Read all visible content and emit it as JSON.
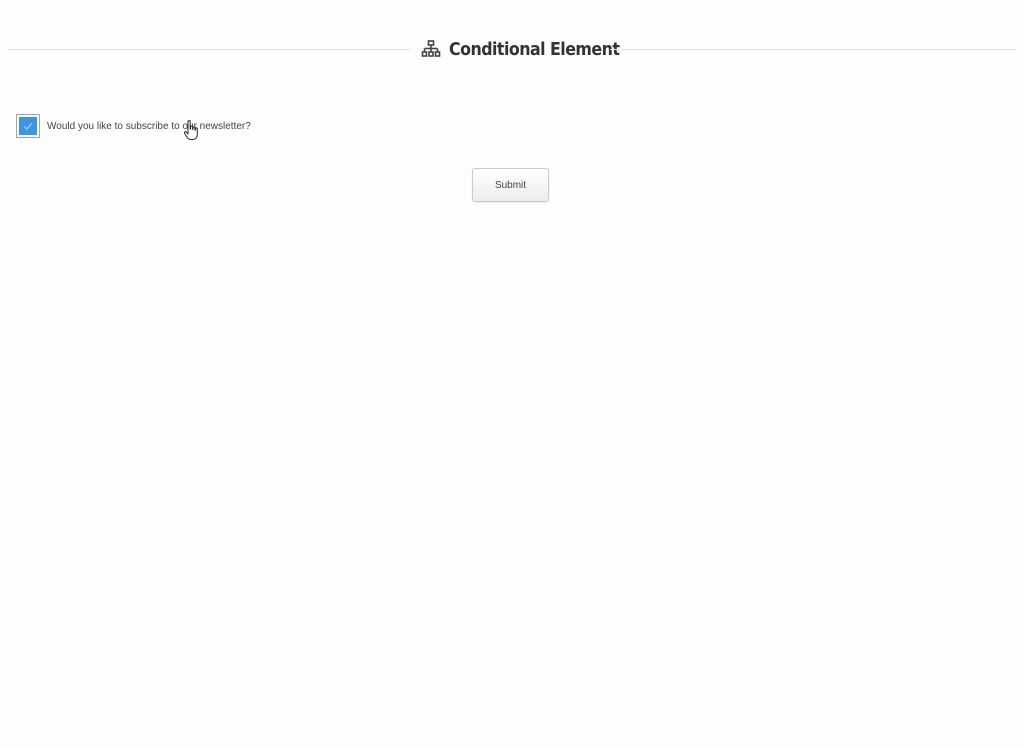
{
  "section": {
    "title": "Conditional Element",
    "icon": "sitemap-icon"
  },
  "newsletter": {
    "label": "Would you like to subscribe to our newsletter?",
    "checked": true,
    "check_color": "#3b97e3"
  },
  "form": {
    "submit_label": "Submit"
  },
  "cursor": {
    "icon": "hand-pointer-cursor-icon"
  }
}
